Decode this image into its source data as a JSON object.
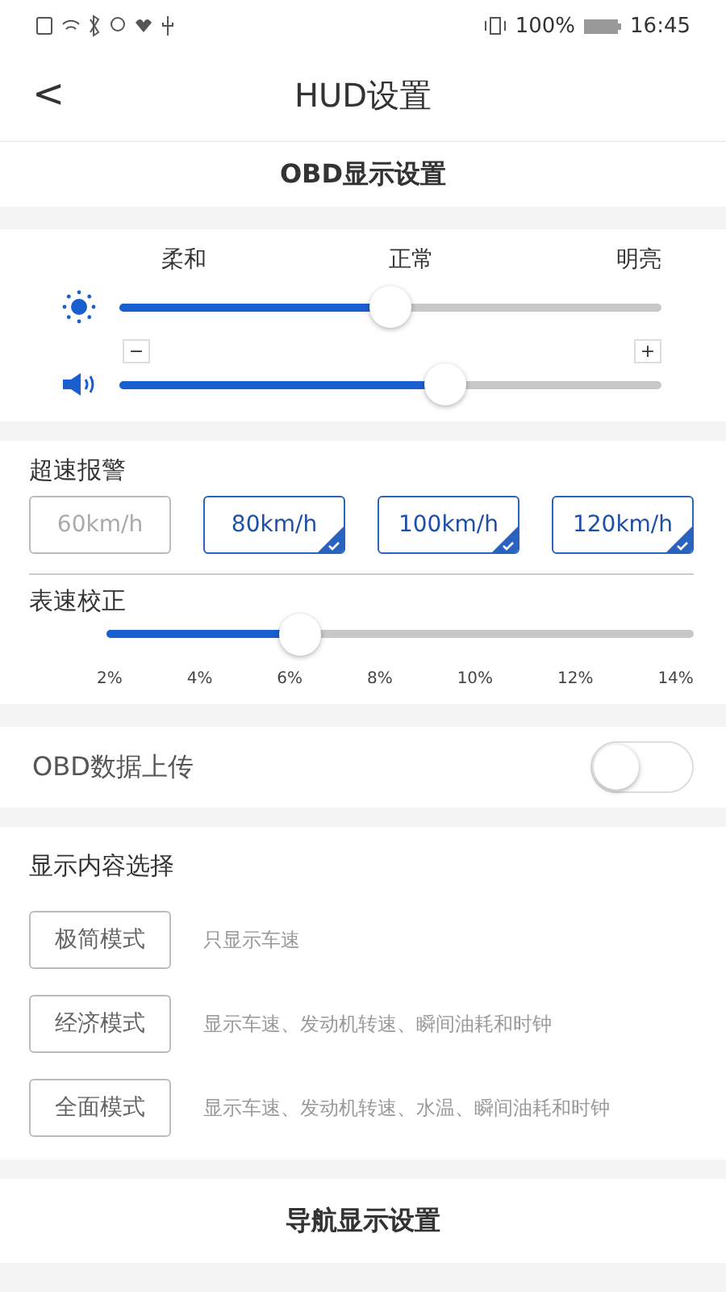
{
  "status_bar": {
    "battery": "100%",
    "time": "16:45"
  },
  "header": {
    "back": "<",
    "title": "HUD设置"
  },
  "obd_section": {
    "title": "OBD显示设置"
  },
  "brightness": {
    "labels": [
      "柔和",
      "正常",
      "明亮"
    ],
    "level": 0.5
  },
  "volume": {
    "minus": "−",
    "plus": "+",
    "level": 0.6
  },
  "speed_alarm": {
    "title": "超速报警",
    "options": [
      {
        "label": "60km/h",
        "selected": false
      },
      {
        "label": "80km/h",
        "selected": true
      },
      {
        "label": "100km/h",
        "selected": true
      },
      {
        "label": "120km/h",
        "selected": true
      }
    ]
  },
  "speed_calibration": {
    "title": "表速校正",
    "level": 0.33,
    "ticks": [
      "2%",
      "4%",
      "6%",
      "8%",
      "10%",
      "12%",
      "14%"
    ]
  },
  "obd_upload": {
    "label": "OBD数据上传",
    "on": false
  },
  "display_content": {
    "title": "显示内容选择",
    "modes": [
      {
        "label": "极简模式",
        "description": "只显示车速"
      },
      {
        "label": "经济模式",
        "description": "显示车速、发动机转速、瞬间油耗和时钟"
      },
      {
        "label": "全面模式",
        "description": "显示车速、发动机转速、水温、瞬间油耗和时钟"
      }
    ]
  },
  "nav_section": {
    "title": "导航显示设置"
  }
}
